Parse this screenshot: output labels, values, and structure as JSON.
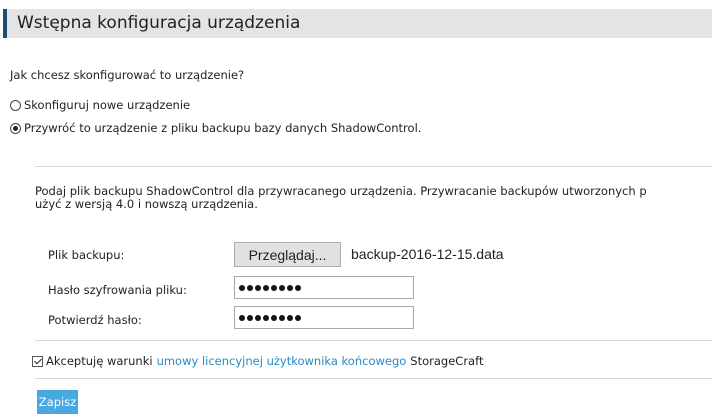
{
  "header": {
    "title": "Wstępna konfiguracja urządzenia"
  },
  "question": "Jak chcesz skonfigurować to urządzenie?",
  "options": [
    {
      "label": "Skonfiguruj nowe urządzenie",
      "selected": false
    },
    {
      "label": "Przywróć to urządzenie z pliku backupu bazy danych ShadowControl.",
      "selected": true
    }
  ],
  "info": {
    "line1": "Podaj plik backupu ShadowControl dla przywracanego urządzenia. Przywracanie backupów utworzonych p",
    "line2": "użyć z wersją 4.0 i nowszą urządzenia."
  },
  "form": {
    "backup_label": "Plik backupu:",
    "browse_label": "Przeglądaj...",
    "filename": "backup-2016-12-15.data",
    "password_label": "Hasło szyfrowania pliku:",
    "confirm_label": "Potwierdź hasło:",
    "password_dots": 8,
    "confirm_dots": 8
  },
  "terms": {
    "prefix": "Akceptuję warunki",
    "link": "umowy licencyjnej użytkownika końcowego",
    "suffix": "StorageCraft",
    "checked": true
  },
  "save_label": "Zapisz",
  "colors": {
    "accent": "#4aa8e0",
    "link": "#2a89c3",
    "header_bar": "#1d4f70",
    "header_bg": "#e4e4e4"
  }
}
